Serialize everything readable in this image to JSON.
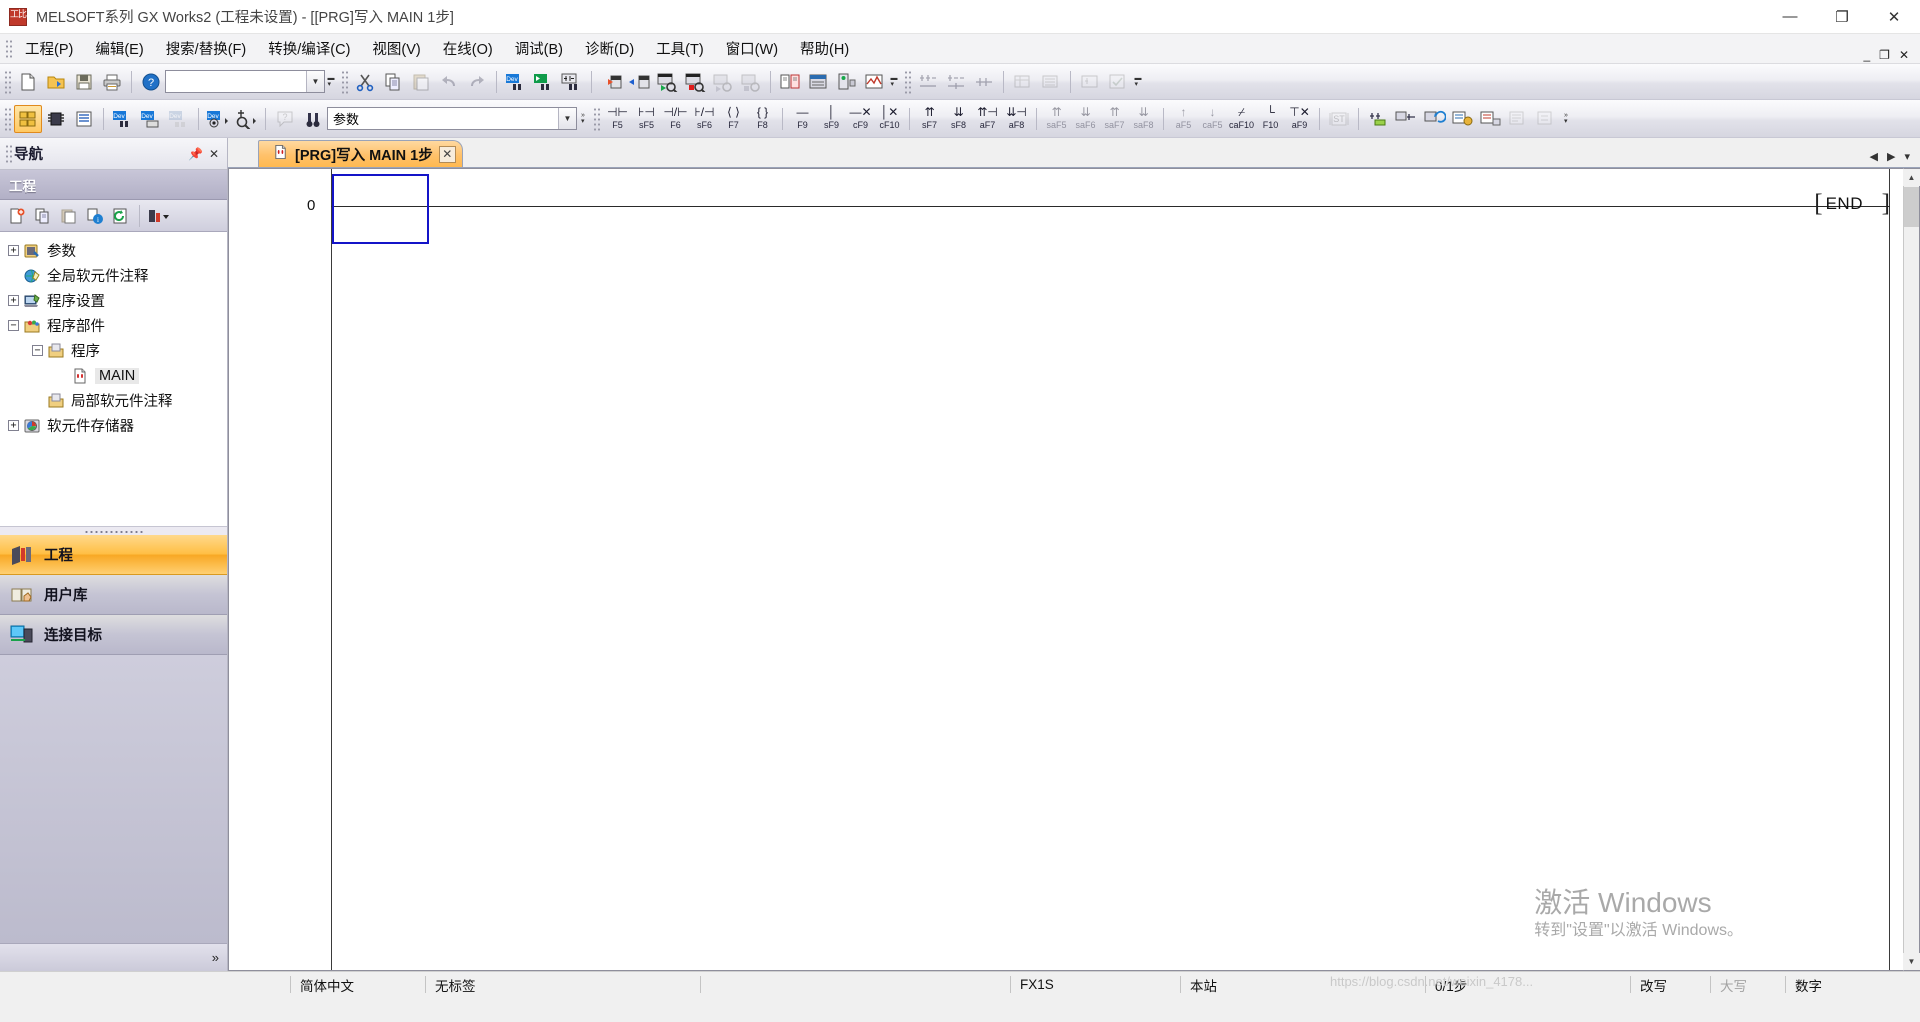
{
  "window": {
    "title": "MELSOFT系列 GX Works2 (工程未设置) - [[PRG]写入 MAIN 1步]",
    "app_icon": "melsoft-icon",
    "minimize": "—",
    "maximize": "❐",
    "close": "✕"
  },
  "menu": {
    "items": [
      {
        "label": "工程(P)"
      },
      {
        "label": "编辑(E)"
      },
      {
        "label": "搜索/替换(F)"
      },
      {
        "label": "转换/编译(C)"
      },
      {
        "label": "视图(V)"
      },
      {
        "label": "在线(O)"
      },
      {
        "label": "调试(B)"
      },
      {
        "label": "诊断(D)"
      },
      {
        "label": "工具(T)"
      },
      {
        "label": "窗口(W)"
      },
      {
        "label": "帮助(H)"
      }
    ],
    "mdi_minimize": "_",
    "mdi_restore": "❐",
    "mdi_close": "✕"
  },
  "toolbar_row1": {
    "combo_value": "",
    "combo_arrow": "▼",
    "overflow": "»",
    "buttons": [
      {
        "name": "new-project-button",
        "icon": "new-document-icon"
      },
      {
        "name": "open-project-button",
        "icon": "open-folder-icon"
      },
      {
        "name": "save-project-button",
        "icon": "floppy-save-icon"
      },
      {
        "name": "print-button",
        "icon": "printer-icon"
      },
      {
        "name": "help-button",
        "icon": "question-help-icon"
      },
      {
        "name": "cut-button",
        "icon": "scissors-icon"
      },
      {
        "name": "copy-button",
        "icon": "copy-icon"
      },
      {
        "name": "paste-button",
        "icon": "paste-icon"
      },
      {
        "name": "undo-button",
        "icon": "undo-arrow-icon"
      },
      {
        "name": "redo-button",
        "icon": "redo-arrow-icon"
      },
      {
        "name": "device-find-button",
        "icon": "device-search-icon"
      },
      {
        "name": "instruction-find-button",
        "icon": "instruction-search-icon"
      },
      {
        "name": "contact-coil-find-button",
        "icon": "contact-search-icon"
      },
      {
        "name": "write-to-plc-button",
        "icon": "write-plc-icon"
      },
      {
        "name": "read-from-plc-button",
        "icon": "read-plc-icon"
      },
      {
        "name": "monitor-start-button",
        "icon": "monitor-start-icon"
      },
      {
        "name": "monitor-stop-button",
        "icon": "monitor-stop-icon"
      },
      {
        "name": "monitor-write-button",
        "icon": "monitor-write-icon"
      },
      {
        "name": "monitor-device-button",
        "icon": "monitor-device-icon"
      },
      {
        "name": "compare-button",
        "icon": "compare-icon"
      },
      {
        "name": "plc-memory-button",
        "icon": "plc-memory-icon"
      },
      {
        "name": "remote-operation-button",
        "icon": "remote-operation-icon"
      },
      {
        "name": "plc-diagnostics-button",
        "icon": "plc-diagnostics-icon"
      },
      {
        "name": "ladder-zoom-button",
        "icon": "ladder-zoom-icon"
      },
      {
        "name": "step-ladder-up-button",
        "icon": "step-up-icon"
      },
      {
        "name": "step-ladder-down-button",
        "icon": "step-down-icon"
      },
      {
        "name": "step-ladder-mid-button",
        "icon": "step-mid-icon"
      },
      {
        "name": "device-batch-button",
        "icon": "device-batch-icon"
      },
      {
        "name": "device-list-button",
        "icon": "device-list-icon"
      },
      {
        "name": "ladder-tool-button",
        "icon": "ladder-tool-icon"
      },
      {
        "name": "program-check-button",
        "icon": "program-check-icon"
      }
    ]
  },
  "toolbar_row2": {
    "combo_value": "参数",
    "combo_arrow": "▼",
    "overflow": "»",
    "left_buttons": [
      {
        "name": "navigation-toggle-button",
        "icon": "navigation-tree-icon"
      },
      {
        "name": "plc-parameter-button",
        "icon": "chip-icon"
      },
      {
        "name": "program-list-button",
        "icon": "document-lines-icon"
      },
      {
        "name": "device-search-button",
        "icon": "dev-search-icon"
      },
      {
        "name": "device-table-button",
        "icon": "dev-table-icon"
      },
      {
        "name": "device-compare-button",
        "icon": "dev-compare-icon"
      },
      {
        "name": "device-watch-button",
        "icon": "dev-watch-icon"
      },
      {
        "name": "device-probe-button",
        "icon": "dev-probe-icon"
      },
      {
        "name": "context-help-button",
        "icon": "balloon-help-icon"
      },
      {
        "name": "find-binoculars-button",
        "icon": "binoculars-icon"
      }
    ],
    "ladder_keys": [
      {
        "name": "open-contact-button",
        "glyph": "⊣⊢",
        "label": "F5",
        "disabled": false
      },
      {
        "name": "open-contact-branch-button",
        "glyph": "⊦⊣",
        "label": "sF5",
        "disabled": false
      },
      {
        "name": "closed-contact-button",
        "glyph": "⊣/⊢",
        "label": "F6",
        "disabled": false
      },
      {
        "name": "closed-contact-branch-button",
        "glyph": "⊦/⊣",
        "label": "sF6",
        "disabled": false
      },
      {
        "name": "coil-button",
        "glyph": "⟨ ⟩",
        "label": "F7",
        "disabled": false
      },
      {
        "name": "application-instruction-button",
        "glyph": "{ }",
        "label": "F8",
        "disabled": false
      },
      {
        "name": "horizontal-line-button",
        "glyph": "—",
        "label": "F9",
        "disabled": false
      },
      {
        "name": "vertical-line-button",
        "glyph": "│",
        "label": "sF9",
        "disabled": false
      },
      {
        "name": "delete-horizontal-line-button",
        "glyph": "—✕",
        "label": "cF9",
        "disabled": false
      },
      {
        "name": "delete-vertical-line-button",
        "glyph": "│✕",
        "label": "cF10",
        "disabled": false
      },
      {
        "name": "rising-pulse-button",
        "glyph": "⇈",
        "label": "sF7",
        "disabled": false
      },
      {
        "name": "falling-pulse-button",
        "glyph": "⇊",
        "label": "sF8",
        "disabled": false
      },
      {
        "name": "rising-pulse-branch-button",
        "glyph": "⇈⊣",
        "label": "aF7",
        "disabled": false
      },
      {
        "name": "falling-pulse-branch-button",
        "glyph": "⇊⊣",
        "label": "aF8",
        "disabled": false
      },
      {
        "name": "invert-rising-button",
        "glyph": "⇈",
        "label": "saF5",
        "disabled": true
      },
      {
        "name": "invert-falling-button",
        "glyph": "⇊",
        "label": "saF6",
        "disabled": true
      },
      {
        "name": "invert-rising-branch-button",
        "glyph": "⇈",
        "label": "saF7",
        "disabled": true
      },
      {
        "name": "invert-falling-branch-button",
        "glyph": "⇊",
        "label": "saF8",
        "disabled": true
      },
      {
        "name": "invert-operation-up-button",
        "glyph": "↑",
        "label": "aF5",
        "disabled": true
      },
      {
        "name": "invert-operation-down-button",
        "glyph": "↓",
        "label": "caF5",
        "disabled": true
      },
      {
        "name": "operation-result-invert-button",
        "glyph": "⌿",
        "label": "caF10",
        "disabled": false
      },
      {
        "name": "line-corner-button",
        "glyph": "└",
        "label": "F10",
        "disabled": false
      },
      {
        "name": "delete-line-button",
        "glyph": "⊤✕",
        "label": "aF9",
        "disabled": false
      }
    ],
    "right_buttons": [
      {
        "name": "structured-text-button",
        "icon": "st-box-icon"
      },
      {
        "name": "ladder-edit-button",
        "icon": "ladder-edit-icon"
      },
      {
        "name": "ladder-insert-button",
        "icon": "ladder-insert-icon"
      },
      {
        "name": "ladder-convert-button",
        "icon": "ladder-convert-icon"
      },
      {
        "name": "comment-display-button",
        "icon": "comment-display-icon"
      },
      {
        "name": "statement-display-button",
        "icon": "statement-display-icon"
      },
      {
        "name": "note-display-button",
        "icon": "note-display-icon"
      },
      {
        "name": "device-comment-button",
        "icon": "device-comment-icon"
      },
      {
        "name": "monitor-mode-button",
        "icon": "monitor-mode-icon"
      }
    ]
  },
  "navigation": {
    "header_title": "导航",
    "pin_icon": "pin-icon",
    "close_icon": "close-icon",
    "section_title": "工程",
    "toolbar_buttons": [
      {
        "name": "new-data-button",
        "icon": "new-data-icon"
      },
      {
        "name": "copy-data-button",
        "icon": "copy-data-icon"
      },
      {
        "name": "paste-data-button",
        "icon": "paste-data-icon"
      },
      {
        "name": "data-properties-button",
        "icon": "properties-icon"
      },
      {
        "name": "refresh-tree-button",
        "icon": "refresh-icon"
      },
      {
        "name": "tree-view-options-button",
        "icon": "view-options-icon"
      }
    ],
    "tree": [
      {
        "label": "参数",
        "expander": "+",
        "icon": "parameter-icon",
        "depth": 0,
        "selected": false
      },
      {
        "label": "全局软元件注释",
        "expander": "",
        "icon": "global-comment-icon",
        "depth": 0,
        "selected": false
      },
      {
        "label": "程序设置",
        "expander": "+",
        "icon": "program-setting-icon",
        "depth": 0,
        "selected": false
      },
      {
        "label": "程序部件",
        "expander": "−",
        "icon": "pou-folder-icon",
        "depth": 0,
        "selected": false
      },
      {
        "label": "程序",
        "expander": "−",
        "icon": "program-folder-icon",
        "depth": 1,
        "selected": false
      },
      {
        "label": "MAIN",
        "expander": "",
        "icon": "ladder-program-icon",
        "depth": 2,
        "selected": true
      },
      {
        "label": "局部软元件注释",
        "expander": "",
        "icon": "local-comment-icon",
        "depth": 1,
        "selected": false
      },
      {
        "label": "软元件存储器",
        "expander": "+",
        "icon": "device-memory-icon",
        "depth": 0,
        "selected": false
      }
    ],
    "buttons": [
      {
        "label": "工程",
        "icon": "project-icon",
        "selected": true
      },
      {
        "label": "用户库",
        "icon": "user-library-icon",
        "selected": false
      },
      {
        "label": "连接目标",
        "icon": "connection-target-icon",
        "selected": false
      }
    ],
    "more_label": "»"
  },
  "editor": {
    "tab": {
      "label": "[PRG]写入 MAIN 1步",
      "icon": "ladder-program-icon",
      "close": "✕"
    },
    "tab_nav": {
      "prev": "◀",
      "next": "▶",
      "list": "▾"
    },
    "ladder": {
      "step_number": "0",
      "end_bracket_left": "[",
      "end_instruction": "END",
      "end_bracket_right": "]",
      "right_rail_bracket": "]"
    },
    "scrollbar": {
      "up": "▲",
      "down": "▼"
    }
  },
  "watermark": {
    "line1": "激活 Windows",
    "line2": "转到\"设置\"以激活 Windows。"
  },
  "statusbar": {
    "language": "简体中文",
    "label": "无标签",
    "empty": "",
    "plc_type": "FX1S",
    "connection": "本站",
    "steps": "0/1步",
    "overwrite": "改写",
    "caps": "大写",
    "numlock": "数字",
    "blog_watermark": "https://blog.csdn.net/weixin_4178..."
  }
}
